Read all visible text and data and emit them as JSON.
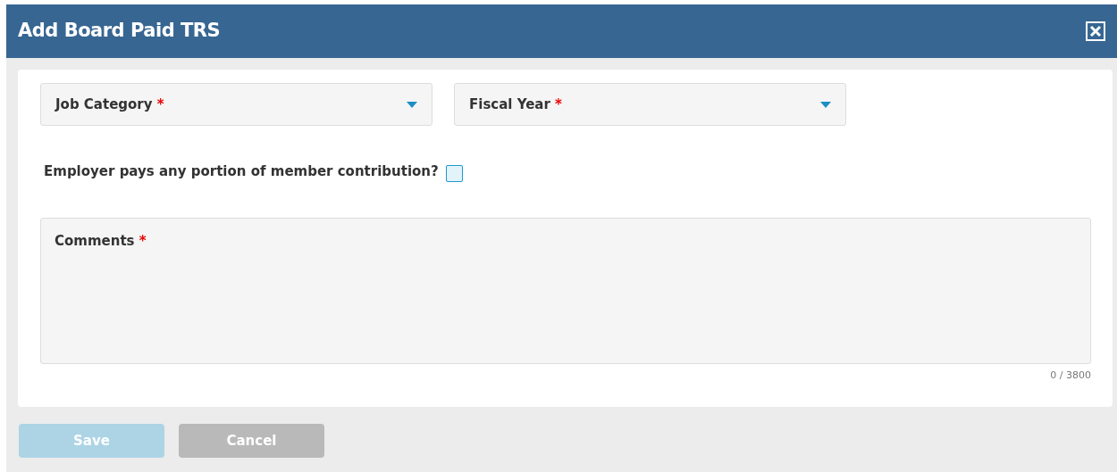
{
  "window": {
    "title": "Add Board Paid TRS"
  },
  "selects": [
    {
      "label": "Job Category",
      "required_mark": "*"
    },
    {
      "label": "Fiscal Year",
      "required_mark": "*"
    }
  ],
  "checkbox": {
    "label": "Employer pays any portion of member contribution?",
    "checked": false
  },
  "comments": {
    "label": "Comments",
    "required_mark": "*",
    "counter": "0 / 3800"
  },
  "buttons": [
    {
      "label": "Save",
      "kind": "primary",
      "disabled": true
    },
    {
      "label": "Cancel",
      "kind": "secondary",
      "disabled": false
    }
  ]
}
